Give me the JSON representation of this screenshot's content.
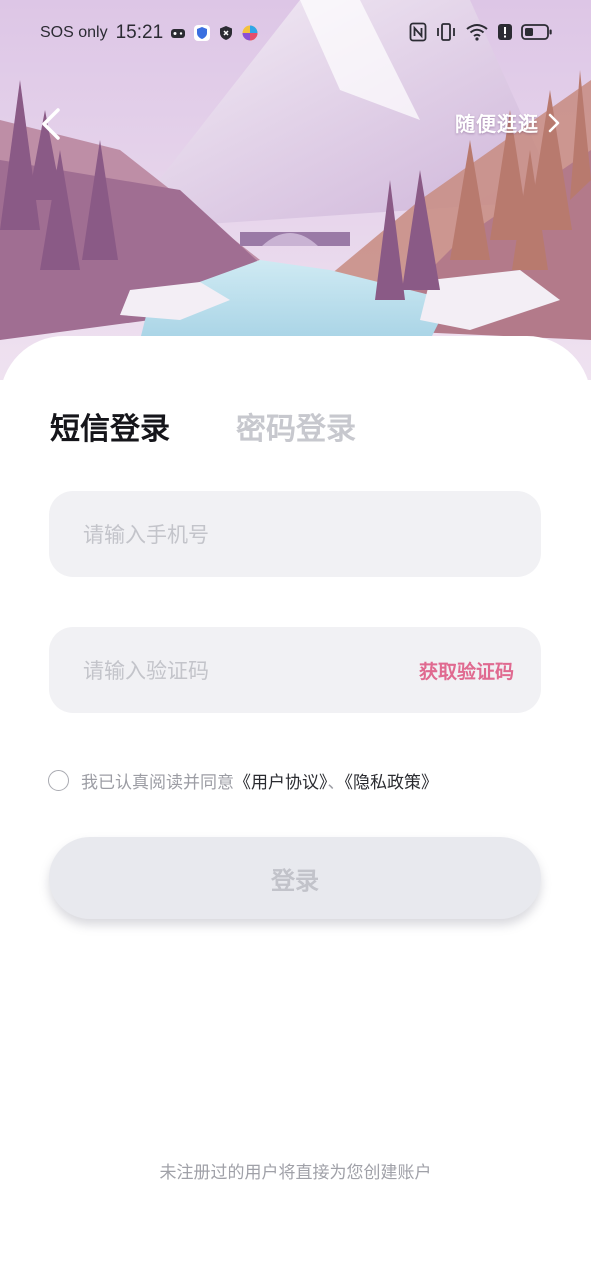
{
  "status_bar": {
    "carrier": "SOS only",
    "time": "15:21",
    "left_icons": [
      "game-icon",
      "shield-icon",
      "security-icon",
      "colorful-app-icon"
    ],
    "right_icons": [
      "nfc-icon",
      "vibrate-icon",
      "wifi-icon",
      "alert-icon",
      "battery-icon"
    ]
  },
  "header": {
    "back_icon": "chevron-left-icon",
    "browse_label": "随便逛逛",
    "browse_icon": "chevron-right-icon"
  },
  "tabs": [
    {
      "label": "短信登录",
      "active": true
    },
    {
      "label": "密码登录",
      "active": false
    }
  ],
  "form": {
    "phone_placeholder": "请输入手机号",
    "code_placeholder": "请输入验证码",
    "get_code_label": "获取验证码"
  },
  "agreement": {
    "checked": false,
    "prefix": "我已认真阅读并同意",
    "user_agreement": "《用户协议》",
    "separator": "、",
    "privacy_policy": "《隐私政策》"
  },
  "login_button": "登录",
  "footer_note": "未注册过的用户将直接为您创建账户",
  "colors": {
    "accent": "#e06a90",
    "tab_highlight": "#f2b5c6",
    "field_bg": "#f1f1f4",
    "button_bg": "#e8e9ee"
  }
}
